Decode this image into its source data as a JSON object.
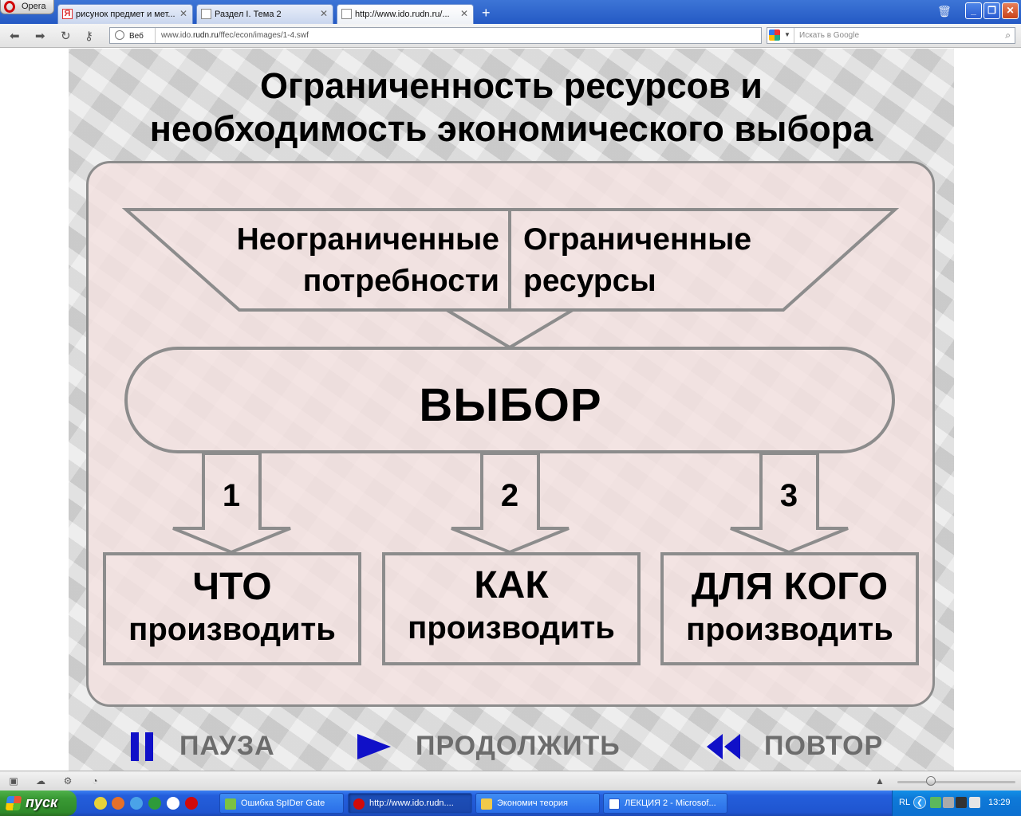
{
  "browser": {
    "menu_label": "Opera",
    "tabs": [
      {
        "title": "рисунок предмет и мет..."
      },
      {
        "title": "Раздел I. Тема 2"
      },
      {
        "title": "http://www.ido.rudn.ru/..."
      }
    ],
    "address": {
      "scope_label": "Веб",
      "url_prefix": "www.ido.",
      "url_domain": "rudn.ru",
      "url_suffix": "/ffec/econ/images/1-4.swf"
    },
    "search_placeholder": "Искать в Google"
  },
  "slide": {
    "title_line1": "Ограниченность ресурсов и",
    "title_line2": "необходимость экономического выбора",
    "needs_line1": "Неограниченные",
    "needs_line2": "потребности",
    "resources_line1": "Ограниченные",
    "resources_line2": "ресурсы",
    "choice": "ВЫБОР",
    "questions": [
      {
        "num": "1",
        "main": "ЧТО",
        "sub": "производить"
      },
      {
        "num": "2",
        "main": "КАК",
        "sub": "производить"
      },
      {
        "num": "3",
        "main": "ДЛЯ КОГО",
        "sub": "производить"
      }
    ],
    "controls": {
      "pause": "ПАУЗА",
      "continue": "ПРОДОЛЖИТЬ",
      "replay": "ПОВТОР"
    },
    "colors": {
      "control_icon": "#1010c8",
      "control_text": "#6c6c6c",
      "outline": "#8c8c8c",
      "panel_fill": "#f4e2e0"
    }
  },
  "taskbar": {
    "start_label": "пуск",
    "tasks": [
      {
        "title": "Ошибка SpIDer Gate"
      },
      {
        "title": "http://www.ido.rudn...."
      },
      {
        "title": "Экономич теория"
      },
      {
        "title": "ЛЕКЦИЯ 2 - Microsof..."
      }
    ],
    "lang": "RL",
    "clock": "13:29"
  }
}
